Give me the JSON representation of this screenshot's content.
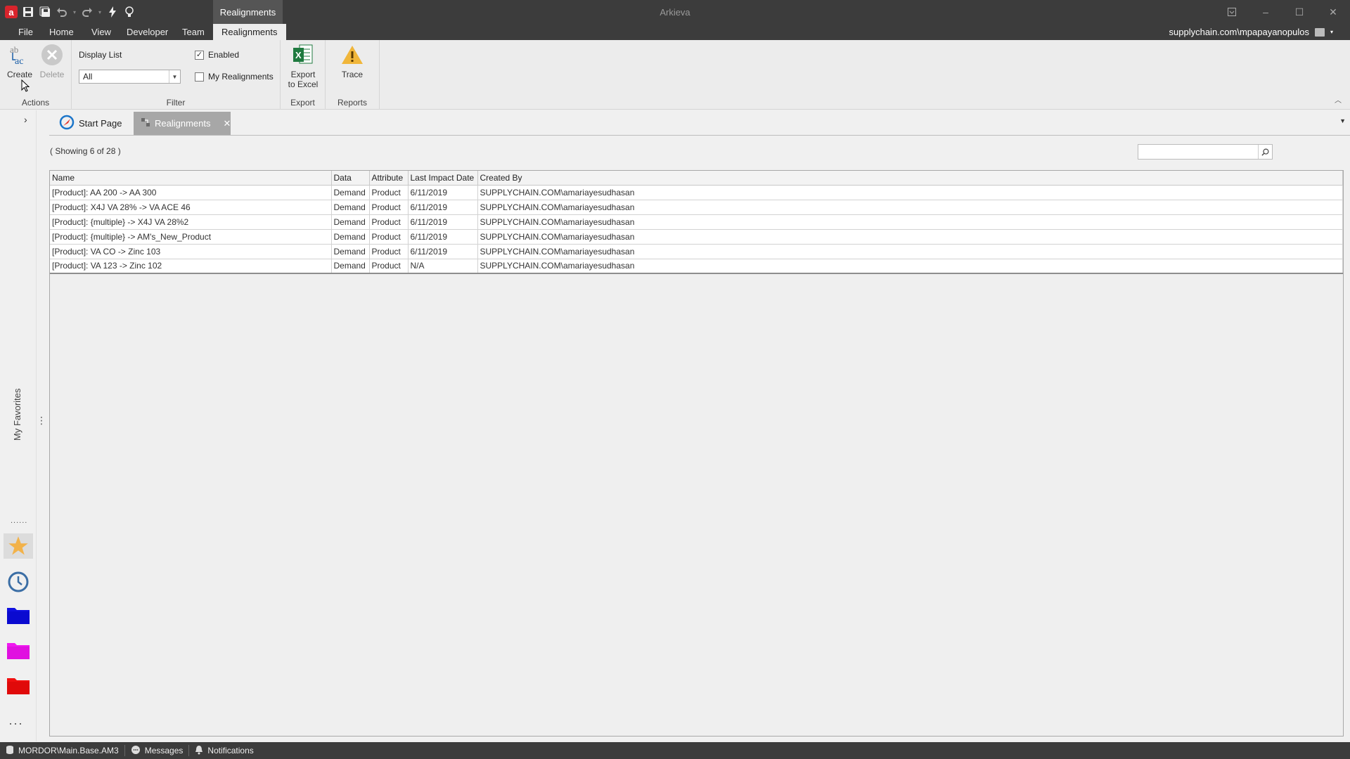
{
  "titlebar": {
    "app_title": "Arkieva",
    "context_tab": "Realignments"
  },
  "menu": {
    "items": [
      "File",
      "Home",
      "View",
      "Developer",
      "Team",
      "Realignments"
    ],
    "user": "supplychain.com\\mpapayanopulos"
  },
  "ribbon": {
    "actions": {
      "create": "Create",
      "delete": "Delete",
      "group_label": "Actions"
    },
    "filter": {
      "display_list_label": "Display List",
      "display_list_value": "All",
      "enabled_label": "Enabled",
      "enabled_checked": true,
      "my_realignments_label": "My Realignments",
      "my_realignments_checked": false,
      "group_label": "Filter"
    },
    "export": {
      "export_line1": "Export",
      "export_line2": "to Excel",
      "group_label": "Export"
    },
    "reports": {
      "trace": "Trace",
      "group_label": "Reports"
    }
  },
  "leftnav": {
    "favorites_label": "My Favorites"
  },
  "tabs": [
    {
      "label": "Start Page"
    },
    {
      "label": "Realignments"
    }
  ],
  "content": {
    "showing": "( Showing 6 of 28 )",
    "search_value": ""
  },
  "grid": {
    "columns": [
      "Name",
      "Data",
      "Attribute",
      "Last Impact Date",
      "Created By"
    ],
    "rows": [
      [
        "[Product]: AA 200 -> AA 300",
        "Demand",
        "Product",
        "6/11/2019",
        "SUPPLYCHAIN.COM\\amariayesudhasan"
      ],
      [
        "[Product]: X4J VA 28% -> VA ACE 46",
        "Demand",
        "Product",
        "6/11/2019",
        "SUPPLYCHAIN.COM\\amariayesudhasan"
      ],
      [
        "[Product]: {multiple} -> X4J VA 28%2",
        "Demand",
        "Product",
        "6/11/2019",
        "SUPPLYCHAIN.COM\\amariayesudhasan"
      ],
      [
        "[Product]: {multiple} -> AM's_New_Product",
        "Demand",
        "Product",
        "6/11/2019",
        "SUPPLYCHAIN.COM\\amariayesudhasan"
      ],
      [
        "[Product]: VA CO -> Zinc 103",
        "Demand",
        "Product",
        "6/11/2019",
        "SUPPLYCHAIN.COM\\amariayesudhasan"
      ],
      [
        "[Product]: VA 123 -> Zinc 102",
        "Demand",
        "Product",
        "N/A",
        "SUPPLYCHAIN.COM\\amariayesudhasan"
      ]
    ]
  },
  "statusbar": {
    "connection": "MORDOR\\Main.Base.AM3",
    "messages": "Messages",
    "notifications": "Notifications"
  },
  "colors": {
    "chrome_dark": "#3c3c3c",
    "ribbon_bg": "#ececec",
    "active_tab": "#a7a7a7",
    "excel_green": "#1f7a3f",
    "warning_yellow": "#f0b63a"
  }
}
